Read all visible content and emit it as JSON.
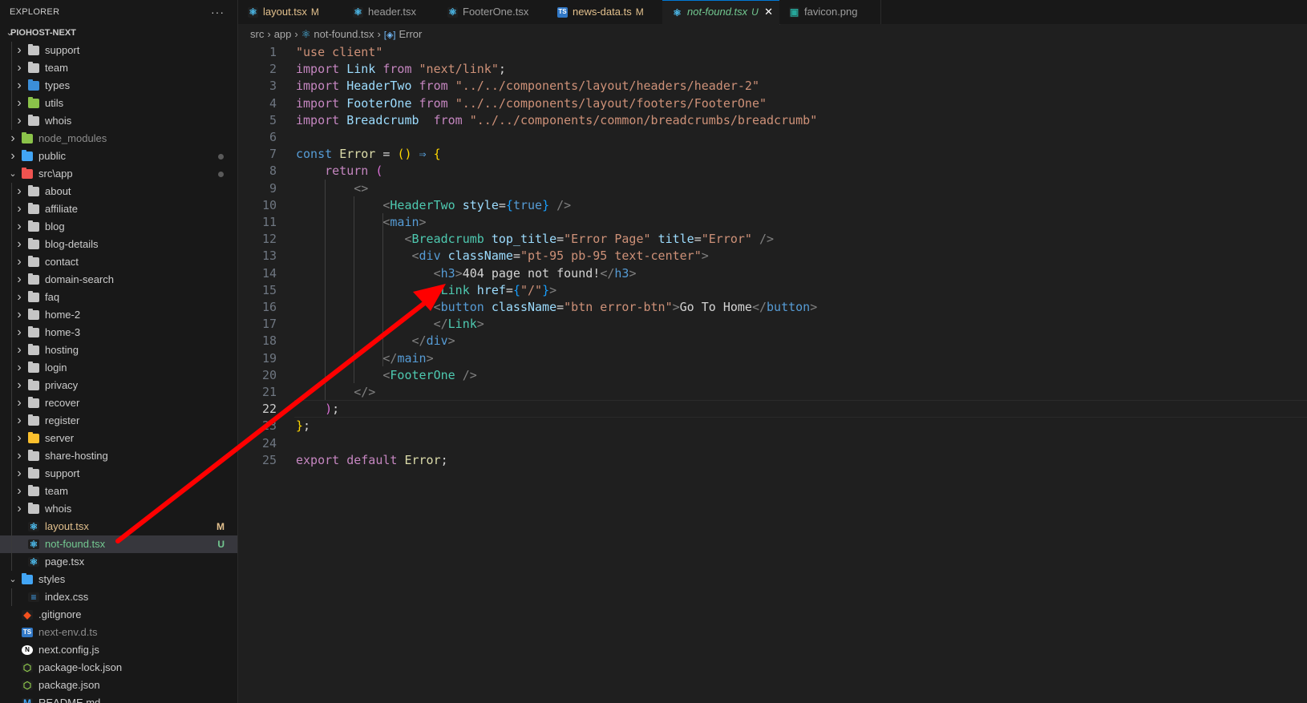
{
  "explorer": {
    "title": "EXPLORER",
    "more": "···",
    "root": "PIOHOST-NEXT"
  },
  "tree": [
    {
      "label": "support",
      "kind": "folder",
      "depth": 1,
      "chevron": "closed",
      "color": "#cccccc"
    },
    {
      "label": "team",
      "kind": "folder",
      "depth": 1,
      "chevron": "closed",
      "color": "#cccccc"
    },
    {
      "label": "types",
      "kind": "folder-ts",
      "depth": 1,
      "chevron": "closed",
      "color": "#cccccc"
    },
    {
      "label": "utils",
      "kind": "folder-utils",
      "depth": 1,
      "chevron": "closed",
      "color": "#cccccc"
    },
    {
      "label": "whois",
      "kind": "folder",
      "depth": 1,
      "chevron": "closed",
      "color": "#cccccc"
    },
    {
      "label": "node_modules",
      "kind": "folder-node",
      "depth": 0,
      "chevron": "closed",
      "color": "#8c8c8c"
    },
    {
      "label": "public",
      "kind": "folder-public",
      "depth": 0,
      "chevron": "closed",
      "color": "#cccccc",
      "dot": true
    },
    {
      "label": "src\\app",
      "kind": "folder-src",
      "depth": 0,
      "chevron": "open",
      "color": "#cccccc",
      "dot": true
    },
    {
      "label": "about",
      "kind": "folder",
      "depth": 1,
      "chevron": "closed",
      "color": "#cccccc"
    },
    {
      "label": "affiliate",
      "kind": "folder",
      "depth": 1,
      "chevron": "closed",
      "color": "#cccccc"
    },
    {
      "label": "blog",
      "kind": "folder",
      "depth": 1,
      "chevron": "closed",
      "color": "#cccccc"
    },
    {
      "label": "blog-details",
      "kind": "folder",
      "depth": 1,
      "chevron": "closed",
      "color": "#cccccc"
    },
    {
      "label": "contact",
      "kind": "folder",
      "depth": 1,
      "chevron": "closed",
      "color": "#cccccc"
    },
    {
      "label": "domain-search",
      "kind": "folder",
      "depth": 1,
      "chevron": "closed",
      "color": "#cccccc"
    },
    {
      "label": "faq",
      "kind": "folder",
      "depth": 1,
      "chevron": "closed",
      "color": "#cccccc"
    },
    {
      "label": "home-2",
      "kind": "folder",
      "depth": 1,
      "chevron": "closed",
      "color": "#cccccc"
    },
    {
      "label": "home-3",
      "kind": "folder",
      "depth": 1,
      "chevron": "closed",
      "color": "#cccccc"
    },
    {
      "label": "hosting",
      "kind": "folder",
      "depth": 1,
      "chevron": "closed",
      "color": "#cccccc"
    },
    {
      "label": "login",
      "kind": "folder",
      "depth": 1,
      "chevron": "closed",
      "color": "#cccccc"
    },
    {
      "label": "privacy",
      "kind": "folder",
      "depth": 1,
      "chevron": "closed",
      "color": "#cccccc"
    },
    {
      "label": "recover",
      "kind": "folder",
      "depth": 1,
      "chevron": "closed",
      "color": "#cccccc"
    },
    {
      "label": "register",
      "kind": "folder",
      "depth": 1,
      "chevron": "closed",
      "color": "#cccccc"
    },
    {
      "label": "server",
      "kind": "folder-server",
      "depth": 1,
      "chevron": "closed",
      "color": "#cccccc"
    },
    {
      "label": "share-hosting",
      "kind": "folder",
      "depth": 1,
      "chevron": "closed",
      "color": "#cccccc"
    },
    {
      "label": "support",
      "kind": "folder",
      "depth": 1,
      "chevron": "closed",
      "color": "#cccccc"
    },
    {
      "label": "team",
      "kind": "folder",
      "depth": 1,
      "chevron": "closed",
      "color": "#cccccc"
    },
    {
      "label": "whois",
      "kind": "folder",
      "depth": 1,
      "chevron": "closed",
      "color": "#cccccc"
    },
    {
      "label": "layout.tsx",
      "kind": "react",
      "depth": 1,
      "chevron": "none",
      "color": "#e2c08d",
      "badge": "M",
      "badge_color": "#e2c08d"
    },
    {
      "label": "not-found.tsx",
      "kind": "react",
      "depth": 1,
      "chevron": "none",
      "color": "#73c991",
      "badge": "U",
      "badge_color": "#73c991",
      "selected": true
    },
    {
      "label": "page.tsx",
      "kind": "react",
      "depth": 1,
      "chevron": "none",
      "color": "#cccccc"
    },
    {
      "label": "styles",
      "kind": "folder-styles",
      "depth": 0,
      "chevron": "open",
      "color": "#cccccc"
    },
    {
      "label": "index.css",
      "kind": "css",
      "depth": 1,
      "chevron": "none",
      "color": "#cccccc"
    },
    {
      "label": ".gitignore",
      "kind": "git",
      "depth": 0,
      "chevron": "none",
      "color": "#cccccc"
    },
    {
      "label": "next-env.d.ts",
      "kind": "ts",
      "depth": 0,
      "chevron": "none",
      "color": "#8c8c8c"
    },
    {
      "label": "next.config.js",
      "kind": "next",
      "depth": 0,
      "chevron": "none",
      "color": "#cccccc"
    },
    {
      "label": "package-lock.json",
      "kind": "node",
      "depth": 0,
      "chevron": "none",
      "color": "#cccccc"
    },
    {
      "label": "package.json",
      "kind": "node",
      "depth": 0,
      "chevron": "none",
      "color": "#cccccc"
    },
    {
      "label": "README.md",
      "kind": "md",
      "depth": 0,
      "chevron": "none",
      "color": "#cccccc"
    }
  ],
  "tabs": [
    {
      "label": "layout.tsx",
      "mod": "M",
      "icon": "react",
      "color": "#e2c08d",
      "mod_color": "#e2c08d",
      "width": 131
    },
    {
      "label": "header.tsx",
      "mod": "",
      "icon": "react",
      "color": "#9d9d9d",
      "mod_color": "",
      "width": 118
    },
    {
      "label": "FooterOne.tsx",
      "mod": "",
      "icon": "react",
      "color": "#9d9d9d",
      "mod_color": "",
      "width": 137
    },
    {
      "label": "news-data.ts",
      "mod": "M",
      "icon": "ts",
      "color": "#e2c08d",
      "mod_color": "#e2c08d",
      "width": 143
    },
    {
      "label": "not-found.tsx",
      "mod": "U",
      "icon": "react",
      "color": "#73c991",
      "mod_color": "#73c991",
      "width": 146,
      "active": true,
      "close": "✕",
      "italic": true
    },
    {
      "label": "favicon.png",
      "mod": "",
      "icon": "png",
      "color": "#9d9d9d",
      "mod_color": "",
      "width": 126
    }
  ],
  "breadcrumb": {
    "parts": [
      "src",
      "app",
      "not-found.tsx",
      "Error"
    ],
    "sep": "›"
  },
  "code": [
    {
      "n": "1",
      "tokens": [
        [
          "s",
          "\"use client\""
        ]
      ]
    },
    {
      "n": "2",
      "tokens": [
        [
          "ctl",
          "import "
        ],
        [
          "id",
          "Link "
        ],
        [
          "ctl",
          "from "
        ],
        [
          "s",
          "\"next/link\""
        ],
        [
          "tx",
          ";"
        ]
      ]
    },
    {
      "n": "3",
      "tokens": [
        [
          "ctl",
          "import "
        ],
        [
          "id",
          "HeaderTwo "
        ],
        [
          "ctl",
          "from "
        ],
        [
          "s",
          "\"../../components/layout/headers/header-2\""
        ]
      ]
    },
    {
      "n": "4",
      "tokens": [
        [
          "ctl",
          "import "
        ],
        [
          "id",
          "FooterOne "
        ],
        [
          "ctl",
          "from "
        ],
        [
          "s",
          "\"../../components/layout/footers/FooterOne\""
        ]
      ]
    },
    {
      "n": "5",
      "tokens": [
        [
          "ctl",
          "import "
        ],
        [
          "id",
          "Breadcrumb  "
        ],
        [
          "ctl",
          "from "
        ],
        [
          "s",
          "\"../../components/common/breadcrumbs/breadcrumb\""
        ]
      ]
    },
    {
      "n": "6",
      "tokens": []
    },
    {
      "n": "7",
      "tokens": [
        [
          "k",
          "const "
        ],
        [
          "fn",
          "Error "
        ],
        [
          "tx",
          "= "
        ],
        [
          "br3",
          "()"
        ],
        [
          "tx",
          " "
        ],
        [
          "k",
          "⇒"
        ],
        [
          "tx",
          " "
        ],
        [
          "br3",
          "{"
        ]
      ]
    },
    {
      "n": "8",
      "tokens": [
        [
          "tx",
          "    "
        ],
        [
          "ctl",
          "return "
        ],
        [
          "br",
          "("
        ]
      ]
    },
    {
      "n": "9",
      "tokens": [
        [
          "tx",
          "        "
        ],
        [
          "pu",
          "<>"
        ]
      ]
    },
    {
      "n": "10",
      "tokens": [
        [
          "tx",
          "            "
        ],
        [
          "pu",
          "<"
        ],
        [
          "tg",
          "HeaderTwo "
        ],
        [
          "at",
          "style"
        ],
        [
          "tx",
          "="
        ],
        [
          "br2",
          "{"
        ],
        [
          "k",
          "true"
        ],
        [
          "br2",
          "}"
        ],
        [
          "tx",
          " "
        ],
        [
          "pu",
          "/>"
        ]
      ]
    },
    {
      "n": "11",
      "tokens": [
        [
          "tx",
          "            "
        ],
        [
          "pu",
          "<"
        ],
        [
          "k",
          "main"
        ],
        [
          "pu",
          ">"
        ]
      ]
    },
    {
      "n": "12",
      "tokens": [
        [
          "tx",
          "               "
        ],
        [
          "pu",
          "<"
        ],
        [
          "tg",
          "Breadcrumb "
        ],
        [
          "at",
          "top_title"
        ],
        [
          "tx",
          "="
        ],
        [
          "s",
          "\"Error Page\" "
        ],
        [
          "at",
          "title"
        ],
        [
          "tx",
          "="
        ],
        [
          "s",
          "\"Error\" "
        ],
        [
          "pu",
          "/>"
        ]
      ]
    },
    {
      "n": "13",
      "tokens": [
        [
          "tx",
          "                "
        ],
        [
          "pu",
          "<"
        ],
        [
          "k",
          "div "
        ],
        [
          "at",
          "className"
        ],
        [
          "tx",
          "="
        ],
        [
          "s",
          "\"pt-95 pb-95 text-center\""
        ],
        [
          "pu",
          ">"
        ]
      ]
    },
    {
      "n": "14",
      "tokens": [
        [
          "tx",
          "                   "
        ],
        [
          "pu",
          "<"
        ],
        [
          "k",
          "h3"
        ],
        [
          "pu",
          ">"
        ],
        [
          "tx",
          "404 page not found!"
        ],
        [
          "pu",
          "</"
        ],
        [
          "k",
          "h3"
        ],
        [
          "pu",
          ">"
        ]
      ]
    },
    {
      "n": "15",
      "tokens": [
        [
          "tx",
          "                   "
        ],
        [
          "pu",
          "<"
        ],
        [
          "tg",
          "Link "
        ],
        [
          "at",
          "href"
        ],
        [
          "tx",
          "="
        ],
        [
          "br2",
          "{"
        ],
        [
          "s",
          "\"/\""
        ],
        [
          "br2",
          "}"
        ],
        [
          "pu",
          ">"
        ]
      ]
    },
    {
      "n": "16",
      "tokens": [
        [
          "tx",
          "                   "
        ],
        [
          "pu",
          "<"
        ],
        [
          "k",
          "button "
        ],
        [
          "at",
          "className"
        ],
        [
          "tx",
          "="
        ],
        [
          "s",
          "\"btn error-btn\""
        ],
        [
          "pu",
          ">"
        ],
        [
          "tx",
          "Go To Home"
        ],
        [
          "pu",
          "</"
        ],
        [
          "k",
          "button"
        ],
        [
          "pu",
          ">"
        ]
      ]
    },
    {
      "n": "17",
      "tokens": [
        [
          "tx",
          "                   "
        ],
        [
          "pu",
          "</"
        ],
        [
          "tg",
          "Link"
        ],
        [
          "pu",
          ">"
        ]
      ]
    },
    {
      "n": "18",
      "tokens": [
        [
          "tx",
          "                "
        ],
        [
          "pu",
          "</"
        ],
        [
          "k",
          "div"
        ],
        [
          "pu",
          ">"
        ]
      ]
    },
    {
      "n": "19",
      "tokens": [
        [
          "tx",
          "            "
        ],
        [
          "pu",
          "</"
        ],
        [
          "k",
          "main"
        ],
        [
          "pu",
          ">"
        ]
      ]
    },
    {
      "n": "20",
      "tokens": [
        [
          "tx",
          "            "
        ],
        [
          "pu",
          "<"
        ],
        [
          "tg",
          "FooterOne "
        ],
        [
          "pu",
          "/>"
        ]
      ]
    },
    {
      "n": "21",
      "tokens": [
        [
          "tx",
          "        "
        ],
        [
          "pu",
          "</>"
        ]
      ]
    },
    {
      "n": "22",
      "tokens": [
        [
          "tx",
          "    "
        ],
        [
          "br",
          ")"
        ],
        [
          "tx",
          ";"
        ]
      ],
      "current": true
    },
    {
      "n": "23",
      "tokens": [
        [
          "br3",
          "}"
        ],
        [
          "tx",
          ";"
        ]
      ]
    },
    {
      "n": "24",
      "tokens": []
    },
    {
      "n": "25",
      "tokens": [
        [
          "ctl",
          "export "
        ],
        [
          "ctl",
          "default "
        ],
        [
          "fn",
          "Error"
        ],
        [
          "tx",
          ";"
        ]
      ]
    }
  ],
  "annotation": {
    "color": "#ff0000"
  },
  "colors": {
    "accent": "#0078d4",
    "modified": "#e2c08d",
    "untracked": "#73c991"
  }
}
